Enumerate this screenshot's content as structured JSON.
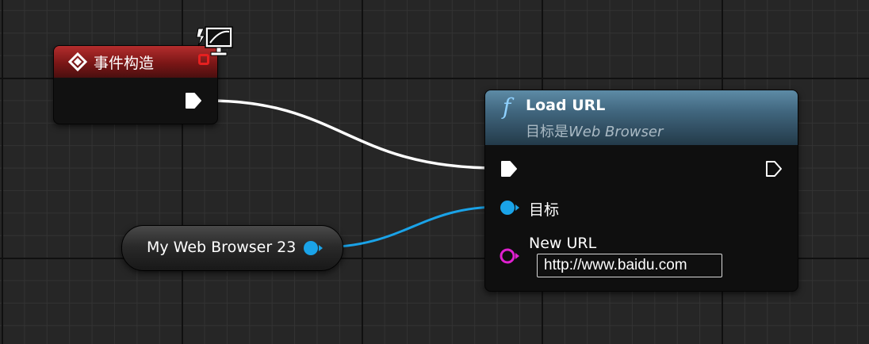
{
  "event_node": {
    "title": "事件构造",
    "icon": "diamond-icon",
    "badge_icon": "monitor-icon",
    "header_color": "#9c2222"
  },
  "function_node": {
    "icon": "function-f-icon",
    "icon_glyph": "f",
    "title": "Load URL",
    "subtitle_prefix": "目标是",
    "subtitle_target": "Web Browser",
    "header_color": "#4a7390",
    "target_pin_label": "目标",
    "url_pin_label": "New URL",
    "url_value": "http://www.baidu.com"
  },
  "variable_node": {
    "label": "My Web Browser 23",
    "pin_color": "#1aa3e8"
  },
  "colors": {
    "exec_wire": "#ffffff",
    "object_wire": "#1aa3e8",
    "string_pin": "#e020d0"
  }
}
